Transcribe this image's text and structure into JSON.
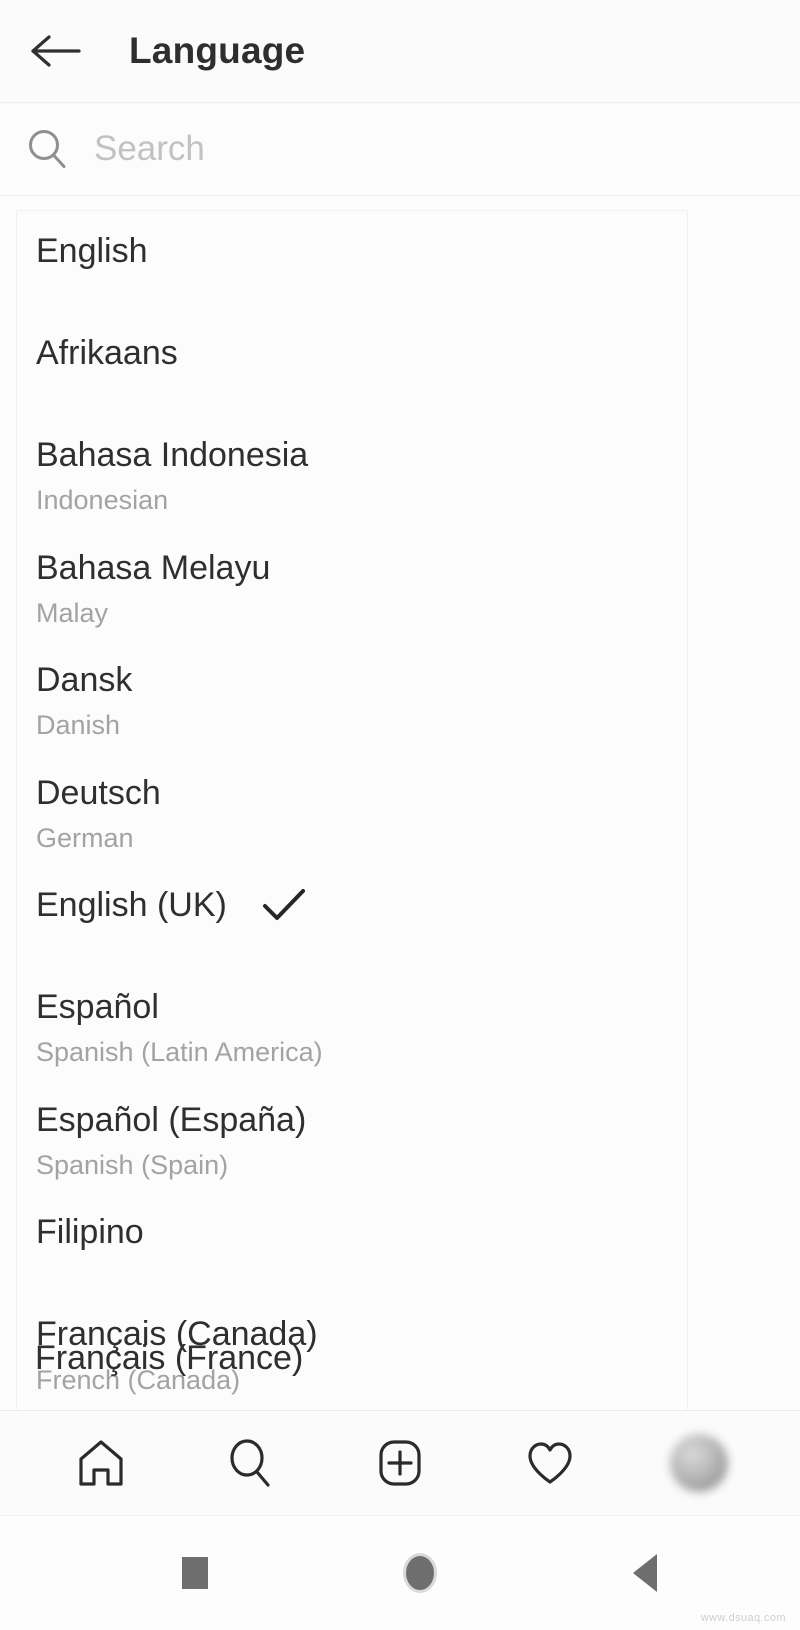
{
  "header": {
    "title": "Language",
    "back_icon": "arrow-left-icon"
  },
  "search": {
    "placeholder": "Search",
    "value": "",
    "icon": "search-icon"
  },
  "language_list": {
    "items": [
      {
        "name": "English",
        "sub": ""
      },
      {
        "name": "Afrikaans",
        "sub": ""
      },
      {
        "name": "Bahasa Indonesia",
        "sub": "Indonesian"
      },
      {
        "name": "Bahasa Melayu",
        "sub": "Malay"
      },
      {
        "name": "Dansk",
        "sub": "Danish"
      },
      {
        "name": "Deutsch",
        "sub": "German"
      },
      {
        "name": "English (UK)",
        "sub": "",
        "selected": true
      },
      {
        "name": "Español",
        "sub": "Spanish (Latin America)"
      },
      {
        "name": "Español (España)",
        "sub": "Spanish (Spain)"
      },
      {
        "name": "Filipino",
        "sub": ""
      },
      {
        "name": "Français (Canada)",
        "sub": "French (Canada)"
      }
    ],
    "overflow_item": "Français (France)",
    "check_icon": "check-icon"
  },
  "tabbar": {
    "items": [
      {
        "icon": "home-icon",
        "label": "Home"
      },
      {
        "icon": "search-icon",
        "label": "Search"
      },
      {
        "icon": "add-post-icon",
        "label": "New post"
      },
      {
        "icon": "heart-icon",
        "label": "Activity"
      },
      {
        "icon": "avatar",
        "label": "Profile"
      }
    ]
  },
  "system_nav": {
    "recents": "square-recents-icon",
    "home": "circle-home-icon",
    "back": "triangle-back-icon"
  },
  "watermark": "www.dsuaq.com",
  "colors": {
    "text_primary": "#2f2f2f",
    "text_secondary": "#a3a3a3",
    "placeholder": "#c2c2c2",
    "background": "#fcfcfc",
    "divider": "#ededed"
  }
}
